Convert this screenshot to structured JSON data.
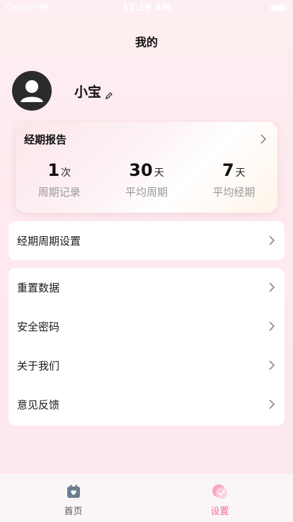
{
  "status_bar": {
    "carrier": "Carrier",
    "time": "12:19 AM"
  },
  "nav": {
    "title": "我的"
  },
  "profile": {
    "name": "小宝"
  },
  "report": {
    "title": "经期报告",
    "stats": [
      {
        "value": "1",
        "unit": "次",
        "label": "周期记录"
      },
      {
        "value": "30",
        "unit": "天",
        "label": "平均周期"
      },
      {
        "value": "7",
        "unit": "天",
        "label": "平均经期"
      }
    ]
  },
  "menu_group_1": [
    {
      "label": "经期周期设置"
    }
  ],
  "menu_group_2": [
    {
      "label": "重置数据"
    },
    {
      "label": "安全密码"
    },
    {
      "label": "关于我们"
    },
    {
      "label": "意见反馈"
    }
  ],
  "tabbar": {
    "tabs": [
      {
        "label": "首页",
        "icon": "calendar-heart-icon",
        "active": false
      },
      {
        "label": "设置",
        "icon": "settings-icon",
        "active": true
      }
    ]
  },
  "colors": {
    "accent": "#f36f9a",
    "background": "#fdeff1",
    "inactive_tab": "#555555"
  }
}
